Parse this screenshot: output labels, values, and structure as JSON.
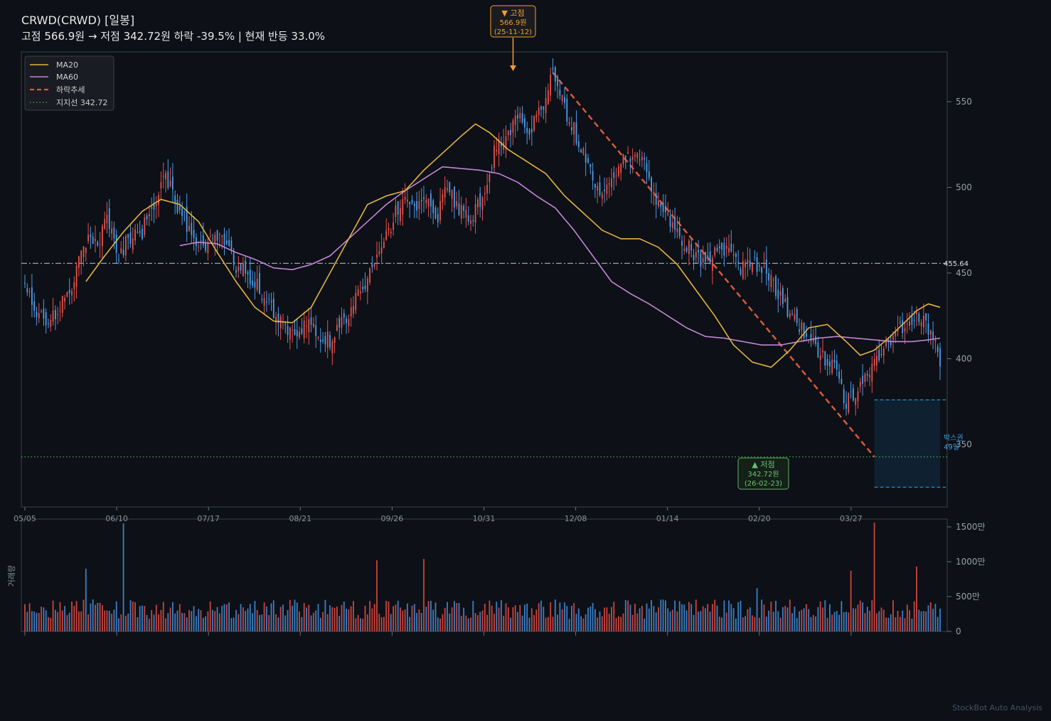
{
  "header": {
    "title": "CRWD(CRWD)  [일봉]",
    "subtitle": "고점 566.9원 → 저점 342.72원  하락 -39.5%  |  현재 반등 33.0%"
  },
  "footer": "StockBot Auto Analysis",
  "colors": {
    "background": "#0d1017",
    "up": "#e5534b",
    "down": "#4a9eea",
    "ma20": "#e3b341",
    "ma60": "#c486d4",
    "trend": "#d95b36",
    "support": "#4caf50",
    "current": "#9aa0a8",
    "box": "#1e8fd0",
    "peak": "#f0a030"
  },
  "legend": {
    "ma20": "MA20",
    "ma60": "MA60",
    "trend": "하락추세",
    "support": "지지선 342.72"
  },
  "annotations": {
    "peak_line1": "▼ 고점",
    "peak_line2": "566.9원",
    "peak_line3": "(25-11-12)",
    "trough_line1": "▲ 저점",
    "trough_line2": "342.72원",
    "trough_line3": "(26-02-23)",
    "current_price": "455.64",
    "box_line1": "박스권",
    "box_line2": "49일"
  },
  "volume_axis_label": "거래량",
  "chart_data": {
    "type": "candlestick",
    "price": {
      "ylim": [
        320,
        580
      ],
      "yticks": [
        350,
        400,
        450,
        500,
        550
      ],
      "xticks": [
        "05/05",
        "06/10",
        "07/17",
        "08/21",
        "09/26",
        "10/31",
        "12/08",
        "01/14",
        "02/20",
        "03/27"
      ],
      "n_sessions": 335,
      "anchors": [
        [
          0,
          443
        ],
        [
          5,
          428
        ],
        [
          10,
          418
        ],
        [
          15,
          432
        ],
        [
          20,
          440
        ],
        [
          25,
          470
        ],
        [
          30,
          465
        ],
        [
          35,
          480
        ],
        [
          40,
          462
        ],
        [
          45,
          470
        ],
        [
          50,
          475
        ],
        [
          55,
          490
        ],
        [
          60,
          508
        ],
        [
          65,
          490
        ],
        [
          70,
          475
        ],
        [
          75,
          466
        ],
        [
          80,
          470
        ],
        [
          85,
          468
        ],
        [
          90,
          455
        ],
        [
          95,
          450
        ],
        [
          100,
          440
        ],
        [
          105,
          428
        ],
        [
          110,
          420
        ],
        [
          115,
          413
        ],
        [
          120,
          420
        ],
        [
          125,
          415
        ],
        [
          130,
          410
        ],
        [
          135,
          420
        ],
        [
          140,
          432
        ],
        [
          145,
          445
        ],
        [
          150,
          458
        ],
        [
          155,
          475
        ],
        [
          160,
          492
        ],
        [
          165,
          488
        ],
        [
          170,
          495
        ],
        [
          175,
          480
        ],
        [
          180,
          500
        ],
        [
          185,
          488
        ],
        [
          190,
          480
        ],
        [
          195,
          495
        ],
        [
          200,
          520
        ],
        [
          205,
          532
        ],
        [
          210,
          540
        ],
        [
          215,
          535
        ],
        [
          220,
          545
        ],
        [
          225,
          566.9
        ],
        [
          230,
          545
        ],
        [
          235,
          530
        ],
        [
          240,
          510
        ],
        [
          245,
          495
        ],
        [
          250,
          505
        ],
        [
          255,
          520
        ],
        [
          260,
          518
        ],
        [
          265,
          510
        ],
        [
          270,
          490
        ],
        [
          275,
          478
        ],
        [
          280,
          470
        ],
        [
          285,
          462
        ],
        [
          290,
          456
        ],
        [
          295,
          465
        ],
        [
          300,
          460
        ],
        [
          305,
          452
        ],
        [
          310,
          458
        ],
        [
          315,
          450
        ],
        [
          320,
          440
        ],
        [
          325,
          428
        ],
        [
          330,
          420
        ],
        [
          335,
          410
        ],
        [
          340,
          400
        ],
        [
          345,
          395
        ],
        [
          350,
          375
        ],
        [
          355,
          380
        ],
        [
          360,
          395
        ],
        [
          365,
          405
        ],
        [
          370,
          412
        ],
        [
          375,
          420
        ],
        [
          380,
          425
        ],
        [
          385,
          418
        ],
        [
          390,
          400
        ]
      ],
      "seed": 20251112
    },
    "moving_averages": {
      "ma20": [
        [
          26,
          445
        ],
        [
          34,
          460
        ],
        [
          42,
          474
        ],
        [
          50,
          486
        ],
        [
          58,
          493
        ],
        [
          66,
          490
        ],
        [
          74,
          480
        ],
        [
          82,
          462
        ],
        [
          90,
          445
        ],
        [
          98,
          430
        ],
        [
          106,
          422
        ],
        [
          114,
          421
        ],
        [
          122,
          430
        ],
        [
          130,
          450
        ],
        [
          138,
          470
        ],
        [
          146,
          490
        ],
        [
          154,
          495
        ],
        [
          162,
          498
        ],
        [
          170,
          510
        ],
        [
          178,
          520
        ],
        [
          186,
          530
        ],
        [
          192,
          537
        ],
        [
          198,
          532
        ],
        [
          206,
          522
        ],
        [
          214,
          515
        ],
        [
          222,
          508
        ],
        [
          230,
          495
        ],
        [
          238,
          485
        ],
        [
          246,
          475
        ],
        [
          254,
          470
        ],
        [
          262,
          470
        ],
        [
          270,
          465
        ],
        [
          278,
          455
        ],
        [
          286,
          440
        ],
        [
          294,
          425
        ],
        [
          302,
          408
        ],
        [
          310,
          398
        ],
        [
          318,
          395
        ],
        [
          326,
          405
        ],
        [
          334,
          418
        ],
        [
          342,
          420
        ],
        [
          350,
          410
        ],
        [
          356,
          402
        ],
        [
          362,
          405
        ],
        [
          368,
          412
        ],
        [
          374,
          420
        ],
        [
          380,
          428
        ],
        [
          385,
          432
        ],
        [
          390,
          430
        ]
      ],
      "ma60": [
        [
          66,
          466
        ],
        [
          74,
          468
        ],
        [
          82,
          467
        ],
        [
          90,
          462
        ],
        [
          98,
          458
        ],
        [
          106,
          453
        ],
        [
          114,
          452
        ],
        [
          122,
          455
        ],
        [
          130,
          460
        ],
        [
          138,
          470
        ],
        [
          146,
          480
        ],
        [
          154,
          490
        ],
        [
          162,
          498
        ],
        [
          170,
          505
        ],
        [
          178,
          512
        ],
        [
          186,
          511
        ],
        [
          194,
          510
        ],
        [
          202,
          508
        ],
        [
          210,
          503
        ],
        [
          218,
          495
        ],
        [
          226,
          488
        ],
        [
          234,
          475
        ],
        [
          242,
          460
        ],
        [
          250,
          445
        ],
        [
          258,
          438
        ],
        [
          266,
          432
        ],
        [
          274,
          425
        ],
        [
          282,
          418
        ],
        [
          290,
          413
        ],
        [
          298,
          412
        ],
        [
          306,
          410
        ],
        [
          314,
          408
        ],
        [
          322,
          408
        ],
        [
          330,
          410
        ],
        [
          338,
          412
        ],
        [
          346,
          413
        ],
        [
          354,
          412
        ],
        [
          362,
          411
        ],
        [
          370,
          410
        ],
        [
          378,
          410
        ],
        [
          385,
          411
        ],
        [
          390,
          412
        ]
      ],
      "smoothing": 8
    },
    "trend_line": [
      [
        225,
        566.9
      ],
      [
        362,
        342.72
      ]
    ],
    "support": 342.72,
    "current_price": 455.64,
    "peak": {
      "index": 225,
      "value": 566.9,
      "date": "25-11-12"
    },
    "trough": {
      "index": 362,
      "value": 342.72,
      "date": "26-02-23"
    },
    "box": {
      "start_index": 362,
      "end_index": 390,
      "top": 376,
      "bottom": 325,
      "days": 49
    },
    "volume": {
      "ylim": [
        0,
        16000000
      ],
      "yticks": [
        0,
        5000000,
        10000000,
        15000000
      ],
      "ytick_labels": [
        "0",
        "500만",
        "1000만",
        "1500만"
      ],
      "spikes": [
        [
          42,
          15500000
        ],
        [
          26,
          9000000
        ],
        [
          150,
          10200000
        ],
        [
          170,
          10400000
        ],
        [
          362,
          15600000
        ],
        [
          352,
          8700000
        ],
        [
          380,
          9300000
        ],
        [
          312,
          6200000
        ]
      ]
    }
  }
}
